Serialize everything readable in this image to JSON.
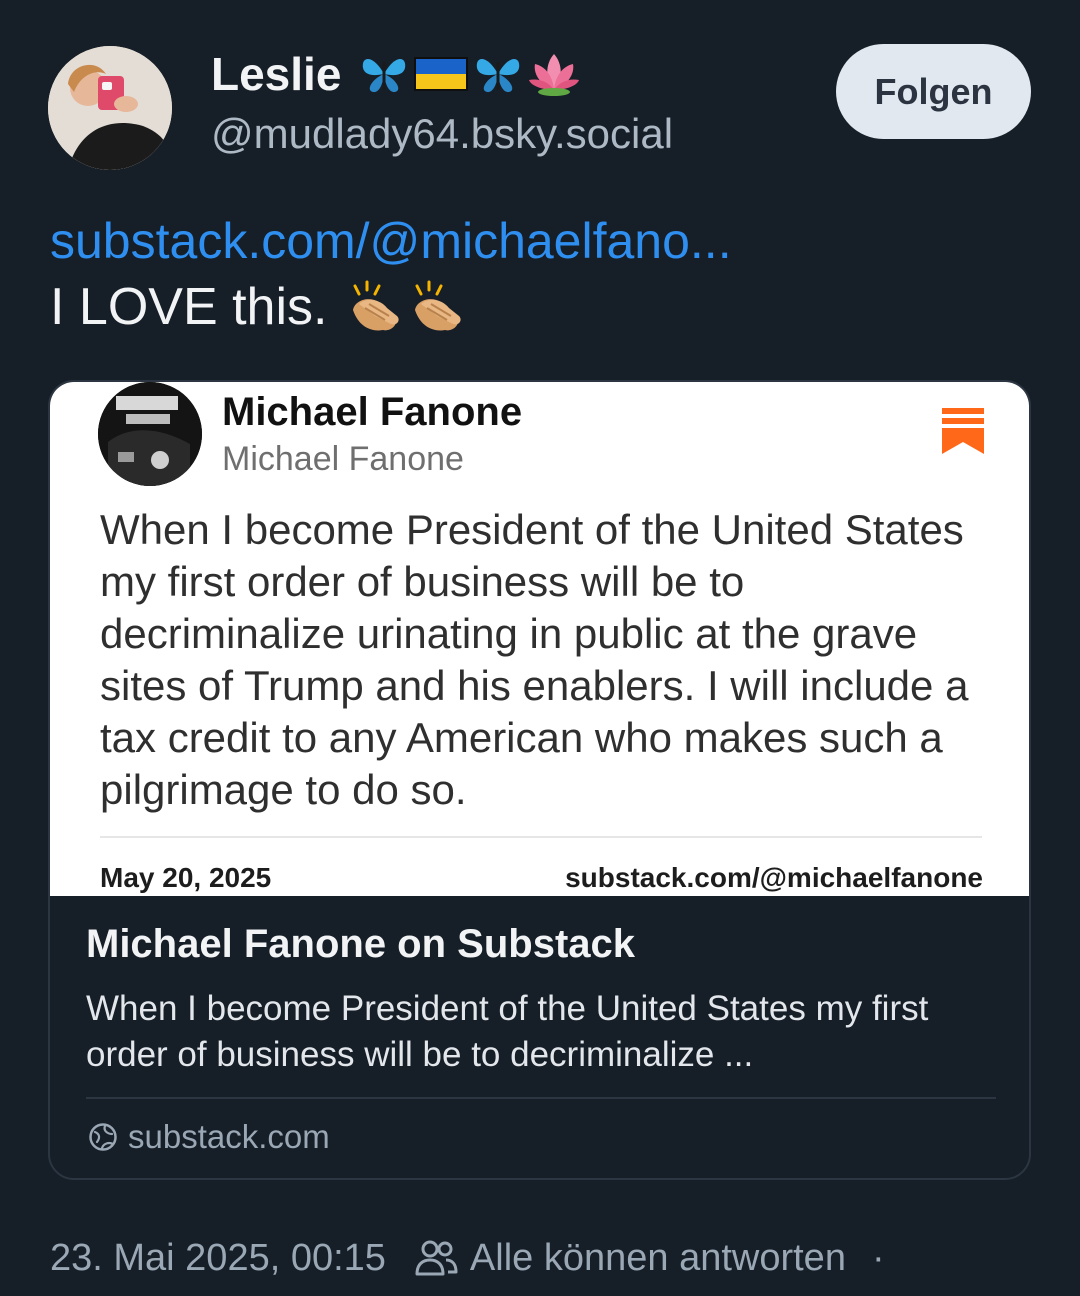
{
  "author": {
    "display_name": "Leslie",
    "handle": "@mudlady64.bsky.social",
    "name_emojis": [
      "butterfly",
      "ukraine-flag",
      "butterfly",
      "lotus"
    ]
  },
  "follow_button": {
    "label": "Folgen"
  },
  "post": {
    "link_text": "substack.com/@michaelfano...",
    "text": "I LOVE this.",
    "emojis": [
      "clapping-hands",
      "clapping-hands"
    ]
  },
  "embed": {
    "image": {
      "name": "Michael Fanone",
      "handle": "Michael Fanone",
      "body": "When I become President of the United States my first order of business will be to decriminalize urinating in public at the grave sites of Trump and his enablers. I will include a tax credit to any American who makes such a pilgrimage to do so.",
      "date": "May 20, 2025",
      "source": "substack.com/@michaelfanone",
      "bookmark_color": "#ff6719"
    },
    "title": "Michael Fanone on Substack",
    "description": "When I become President of the United States my first order of business will be to decriminalize ...",
    "domain": "substack.com"
  },
  "meta": {
    "timestamp": "23. Mai 2025, 00:15",
    "reply_setting": "Alle können antworten",
    "separator": "·"
  },
  "colors": {
    "background": "#161e27",
    "link": "#2f8ff0",
    "text_primary": "#f1f3f5",
    "text_secondary": "#9aa7b5"
  }
}
